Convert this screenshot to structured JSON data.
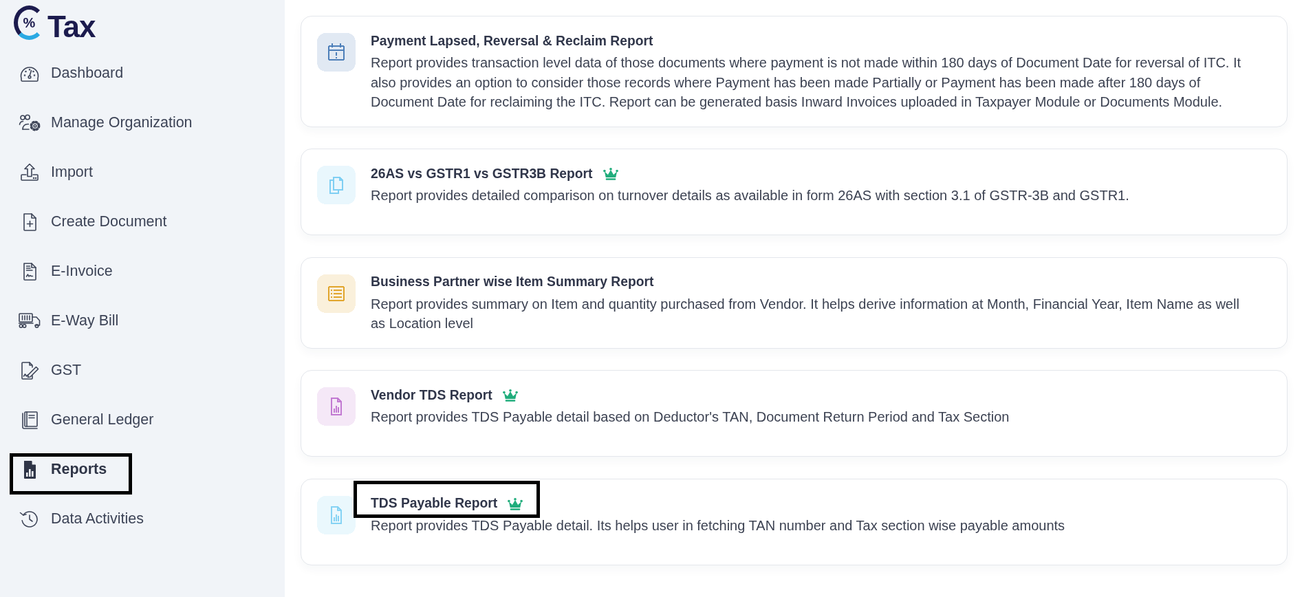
{
  "logo": {
    "symbol": "%",
    "text": "Tax"
  },
  "sidebar": {
    "items": [
      {
        "label": "Dashboard",
        "selected": false,
        "highlighted": false
      },
      {
        "label": "Manage Organization",
        "selected": false,
        "highlighted": false
      },
      {
        "label": "Import",
        "selected": false,
        "highlighted": false
      },
      {
        "label": "Create Document",
        "selected": false,
        "highlighted": false
      },
      {
        "label": "E-Invoice",
        "selected": false,
        "highlighted": false
      },
      {
        "label": "E-Way Bill",
        "selected": false,
        "highlighted": false
      },
      {
        "label": "GST",
        "selected": false,
        "highlighted": false
      },
      {
        "label": "General Ledger",
        "selected": false,
        "highlighted": false
      },
      {
        "label": "Reports",
        "selected": true,
        "highlighted": true
      },
      {
        "label": "Data Activities",
        "selected": false,
        "highlighted": false
      }
    ]
  },
  "reports": [
    {
      "title": "Payment Lapsed, Reversal & Reclaim Report",
      "description": "Report provides transaction level data of those documents where payment is not made within 180 days of Document Date for reversal of ITC. It also provides an option to consider those records where Payment has been made Partially or Payment has been made after 180 days of Document Date for reclaiming the ITC. Report can be generated basis Inward Invoices uploaded in Taxpayer Module or Documents Module.",
      "color": "#4d7fb9",
      "premium": false,
      "highlighted": false
    },
    {
      "title": "26AS vs GSTR1 vs GSTR3B Report",
      "description": "Report provides detailed comparison on turnover details as available in form 26AS with section 3.1 of GSTR-3B and GSTR1.",
      "color": "#7fcff3",
      "premium": true,
      "highlighted": false
    },
    {
      "title": "Business Partner wise Item Summary Report",
      "description": "Report provides summary on Item and quantity purchased from Vendor. It helps derive information at Month, Financial Year, Item Name as well as Location level",
      "color": "#e1a52c",
      "premium": false,
      "highlighted": false
    },
    {
      "title": "Vendor TDS Report",
      "description": "Report provides TDS Payable detail based on Deductor's TAN, Document Return Period and Tax Section",
      "color": "#c27ad2",
      "premium": true,
      "highlighted": false
    },
    {
      "title": "TDS Payable Report",
      "description": "Report provides TDS Payable detail. Its helps user in fetching TAN number and Tax section wise payable amounts",
      "color": "#86d3f4",
      "premium": true,
      "highlighted": true
    }
  ]
}
